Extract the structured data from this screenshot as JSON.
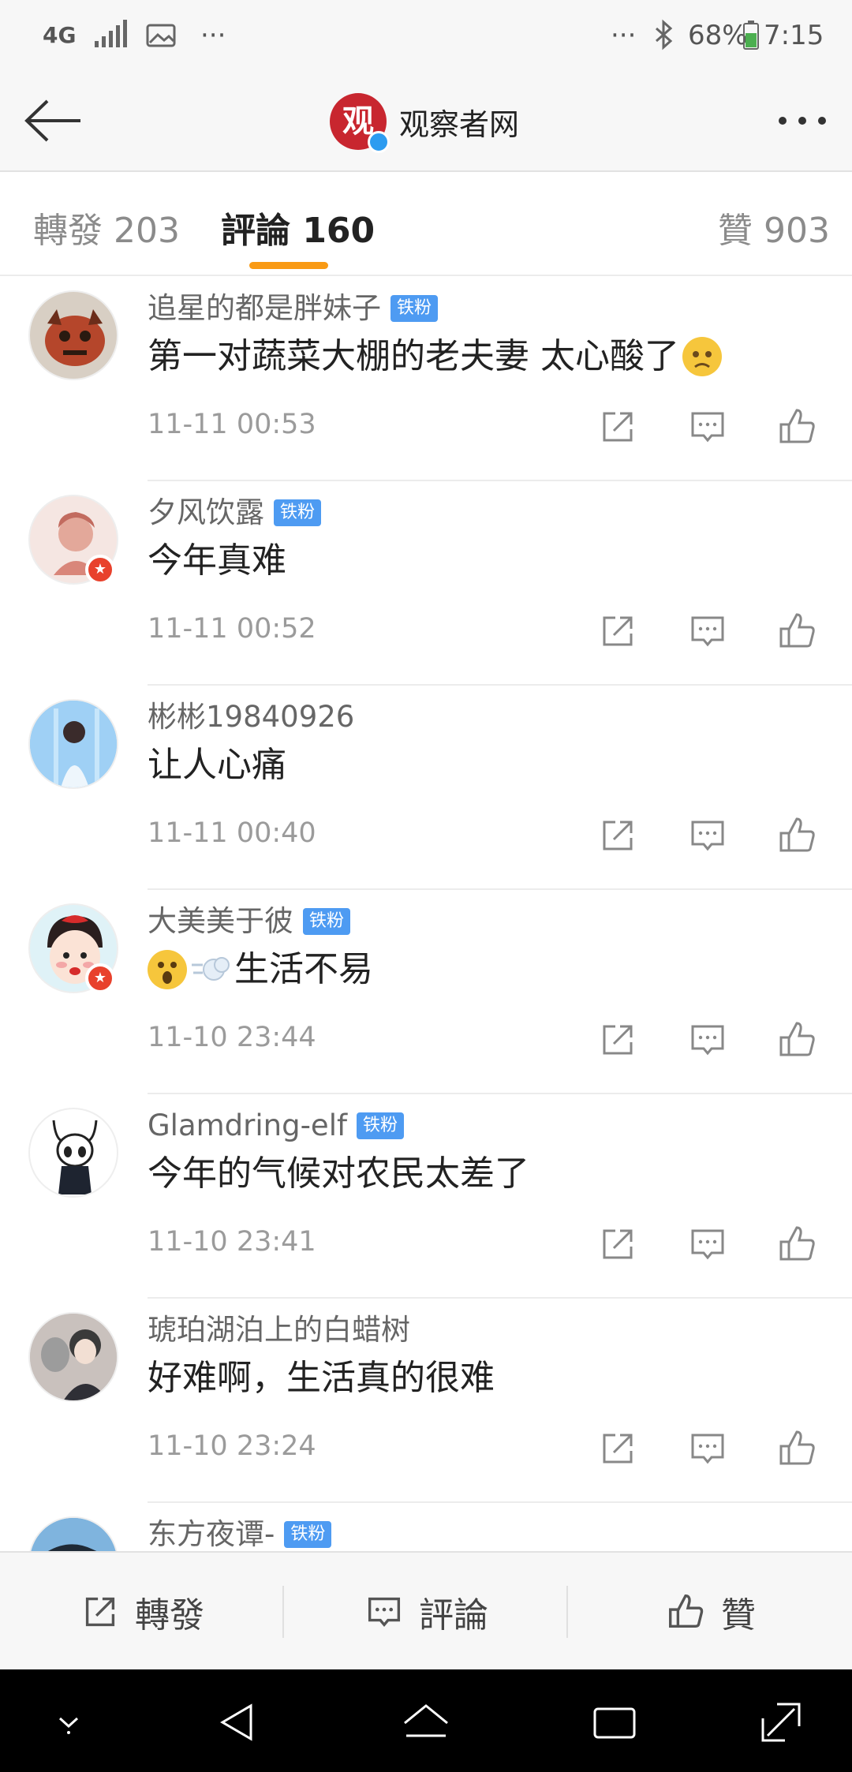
{
  "status_bar": {
    "network": "4G",
    "overflow": "···",
    "overflow_right": "···",
    "battery": "68%",
    "time": "7:15"
  },
  "nav": {
    "title": "观察者网",
    "logo_glyph": "观"
  },
  "tabs": [
    {
      "label": "轉發 203"
    },
    {
      "label": "評論 160"
    },
    {
      "label": "贊 903"
    }
  ],
  "fan_badge": "铁粉",
  "comments": [
    {
      "username": "追星的都是胖妹子",
      "fan": true,
      "text": "第一对蔬菜大棚的老夫妻 太心酸了",
      "emoji": "sad-face-emoji",
      "time": "11-11 00:53"
    },
    {
      "username": "夕风饮露",
      "fan": true,
      "text": "今年真难",
      "time": "11-11 00:52"
    },
    {
      "username": "彬彬19840926",
      "fan": false,
      "text": "让人心痛",
      "time": "11-11 00:40"
    },
    {
      "username": "大美美于彼",
      "fan": true,
      "text": "生活不易",
      "emoji": "surprised-face-emoji",
      "time": "11-10 23:44"
    },
    {
      "username": "Glamdring-elf",
      "fan": true,
      "text": "今年的气候对农民太差了",
      "time": "11-10 23:41"
    },
    {
      "username": "琥珀湖泊上的白蜡树",
      "fan": false,
      "text": "好难啊，生活真的很难",
      "time": "11-10 23:24"
    },
    {
      "username": "东方夜谭-",
      "fan": true,
      "text": "",
      "time": ""
    }
  ],
  "bottom_bar": {
    "repost": "轉發",
    "comment": "評論",
    "like": "贊"
  },
  "colors": {
    "accent": "#f99a14",
    "brand_red": "#c8262f",
    "fan_badge": "#4e9bf2"
  }
}
